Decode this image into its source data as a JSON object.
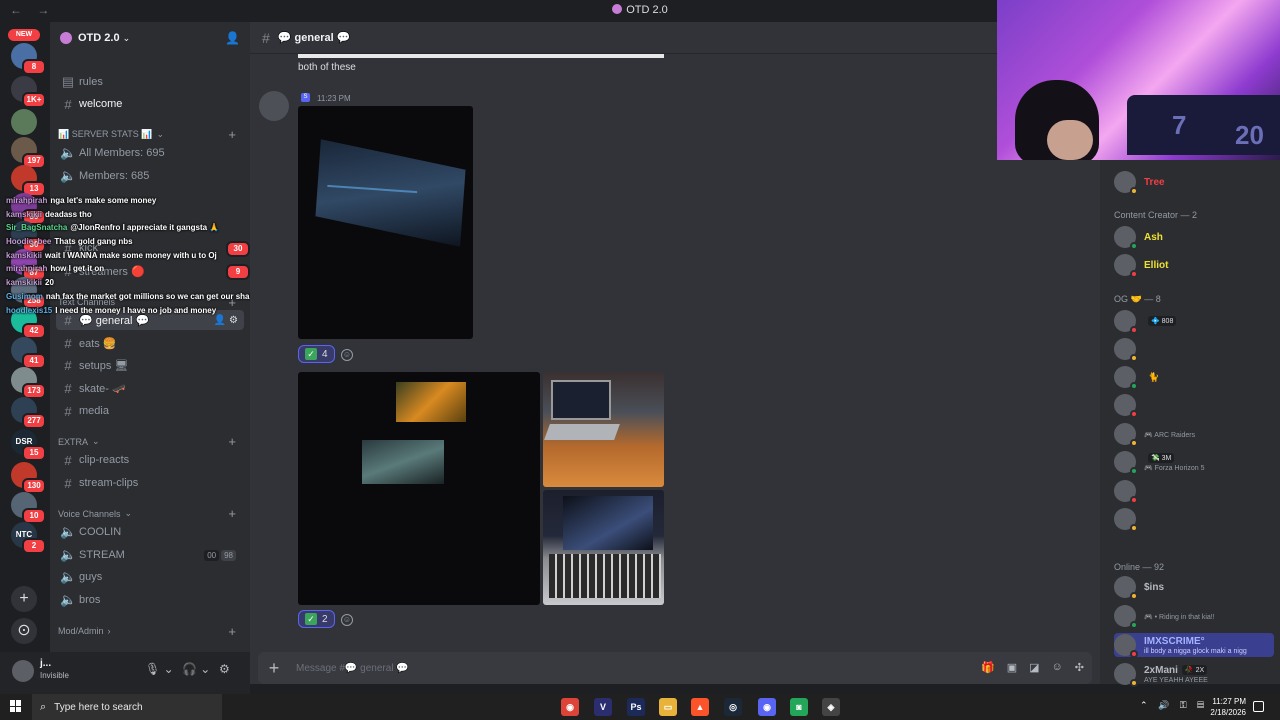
{
  "window": {
    "title": "OTD 2.0",
    "nav": "← →"
  },
  "rail": {
    "new_label": "NEW",
    "servers": [
      {
        "color": "#4a6fa5",
        "badge": "8"
      },
      {
        "color": "#3b3b45",
        "badge": "1K+"
      },
      {
        "color": "#5a7a5a",
        "badge": ""
      },
      {
        "color": "#6b5a4a",
        "badge": "197"
      },
      {
        "color": "#c0392b",
        "badge": "13"
      },
      {
        "color": "#7d3c98",
        "badge": "39"
      },
      {
        "color": "#2c3e50",
        "badge": "30"
      },
      {
        "color": "#8e44ad",
        "badge": "87"
      },
      {
        "color": "#5d6d7e",
        "badge": "258"
      },
      {
        "color": "#1abc9c",
        "badge": "42"
      },
      {
        "color": "#34495e",
        "badge": "41"
      },
      {
        "color": "#7f8c8d",
        "badge": "173"
      },
      {
        "color": "#2e4053",
        "badge": "277"
      },
      {
        "color": "#1c2833",
        "badge": "15",
        "text": "DSR"
      },
      {
        "color": "#c0392b",
        "badge": "130"
      },
      {
        "color": "#566573",
        "badge": "10"
      },
      {
        "color": "#283747",
        "badge": "2",
        "text": "NTC"
      }
    ],
    "add_server": "+",
    "discover": "⊙"
  },
  "sidebar": {
    "server_name": "OTD 2.0",
    "channels_top": [
      {
        "name": "rules",
        "icon": "rules-icon"
      },
      {
        "name": "welcome",
        "icon": "hash-icon"
      }
    ],
    "stats_category": "📊 SERVER STATS 📊",
    "stats": [
      {
        "name": "All Members: 695"
      },
      {
        "name": "Members: 685"
      }
    ],
    "kick_label": "kick",
    "kick_badge": "30",
    "streamers_label": "streamers 🔴",
    "streamers_badge": "9",
    "text_category": "Text Channels",
    "text_channels": [
      {
        "name": "💬 general 💬",
        "active": true
      },
      {
        "name": "eats 🍔"
      },
      {
        "name": "setups 🖥"
      },
      {
        "name": "skate- 🛹"
      },
      {
        "name": "media"
      }
    ],
    "extra_category": "EXTRA",
    "extra_channels": [
      {
        "name": "clip-reacts"
      },
      {
        "name": "stream-clips"
      }
    ],
    "voice_category": "Voice Channels",
    "voice_channels": [
      {
        "name": "COOLIN"
      },
      {
        "name": "STREAM",
        "badge_a": "00",
        "badge_b": "98"
      },
      {
        "name": "guys"
      },
      {
        "name": "bros"
      }
    ],
    "modadmin_category": "Mod/Admin"
  },
  "user": {
    "name": "j...",
    "status": "Invisible"
  },
  "overlay_chat": [
    {
      "user": "mirahpirah",
      "color": "#c39bd3",
      "text": "nga let's make some money"
    },
    {
      "user": "kamskikii",
      "color": "#c39bd3",
      "text": "deadass tho"
    },
    {
      "user": "Sir_BagSnatcha",
      "color": "#58d68d",
      "text": "@JlonRenfro I appreciate it gangsta 🙏"
    },
    {
      "user": "Hoodie_bee",
      "color": "#c39bd3",
      "text": "Thats gold gang nbs"
    },
    {
      "user": "kamskikii",
      "color": "#c39bd3",
      "text": "wait I WANNA make some money with u to Oj"
    },
    {
      "user": "mirahpirah",
      "color": "#c39bd3",
      "text": "how I get it on"
    },
    {
      "user": "kamskikii",
      "color": "#c39bd3",
      "text": "20"
    },
    {
      "user": "Gusimom",
      "color": "#5dade2",
      "text": "nah fax the market got millions so we can get our share fs"
    },
    {
      "user": "hoodlexis15",
      "color": "#5dade2",
      "text": "I need the money I have no job and money"
    }
  ],
  "chat": {
    "channel_name": "💬 general 💬",
    "prev_message": "both of these",
    "message_time": "11:23 PM",
    "reaction1": {
      "emoji": "✅",
      "count": "4"
    },
    "reaction2": {
      "emoji": "✅",
      "count": "2"
    },
    "composer_placeholder": "Message #💬 general 💬"
  },
  "members": {
    "top_member": {
      "name": "Tree",
      "color": "#f23f43"
    },
    "groups": [
      {
        "title": "Content Creator — 2",
        "members": [
          {
            "name": "Ash",
            "color": "#f0e130"
          },
          {
            "name": "Elliot",
            "color": "#f0e130"
          }
        ]
      },
      {
        "title": "OG 🤝 — 8",
        "members": [
          {
            "name": "",
            "color": "#5c5f66",
            "tag": "💠 808"
          },
          {
            "name": "",
            "color": "#5c5f66"
          },
          {
            "name": "",
            "color": "#5c5f66",
            "extra": "🐈"
          },
          {
            "name": "",
            "color": "#5c5f66"
          },
          {
            "name": "",
            "color": "#5c5f66",
            "sub": "🎮 ARC Raiders"
          },
          {
            "name": "",
            "color": "#5c5f66",
            "tag": "💸 3M",
            "sub": "🎮 Forza Horizon 5"
          },
          {
            "name": "",
            "color": "#5c5f66"
          },
          {
            "name": "",
            "color": "#5c5f66"
          }
        ]
      },
      {
        "title": "Online — 92",
        "members": [
          {
            "name": "$ins",
            "color": "#b5bac1"
          },
          {
            "name": "",
            "color": "#b5bac1",
            "sub": "🎮 • Riding in that kia!!"
          },
          {
            "name": "IMXSCRIME°",
            "color": "#a3b3ff",
            "sub": "ill body a nigga glock maki a nigg",
            "highlight": true
          },
          {
            "name": "2xMani",
            "color": "#b5bac1",
            "tag": "🥀 2X",
            "sub": "AYE YEAHH AYEEE"
          },
          {
            "name": "",
            "color": "#b5bac1"
          }
        ]
      }
    ]
  },
  "webcam": {
    "jersey_number_a": "7",
    "jersey_number_b": "20"
  },
  "taskbar": {
    "search_placeholder": "Type here to search",
    "apps": [
      {
        "name": "chrome",
        "color": "#db4437",
        "glyph": "◉"
      },
      {
        "name": "vscode-v",
        "color": "#2a2d6e",
        "glyph": "V"
      },
      {
        "name": "photoshop",
        "color": "#1c2a5a",
        "glyph": "Ps"
      },
      {
        "name": "explorer",
        "color": "#e8b33a",
        "glyph": "▭"
      },
      {
        "name": "brave",
        "color": "#fb542b",
        "glyph": "▲"
      },
      {
        "name": "steam",
        "color": "#1b2838",
        "glyph": "◎"
      },
      {
        "name": "discord-alt",
        "color": "#5865f2",
        "glyph": "◉"
      },
      {
        "name": "discord",
        "color": "#23a55a",
        "glyph": "◙"
      },
      {
        "name": "app",
        "color": "#444",
        "glyph": "◈"
      }
    ],
    "time": "11:27 PM",
    "date": "2/18/2026"
  }
}
